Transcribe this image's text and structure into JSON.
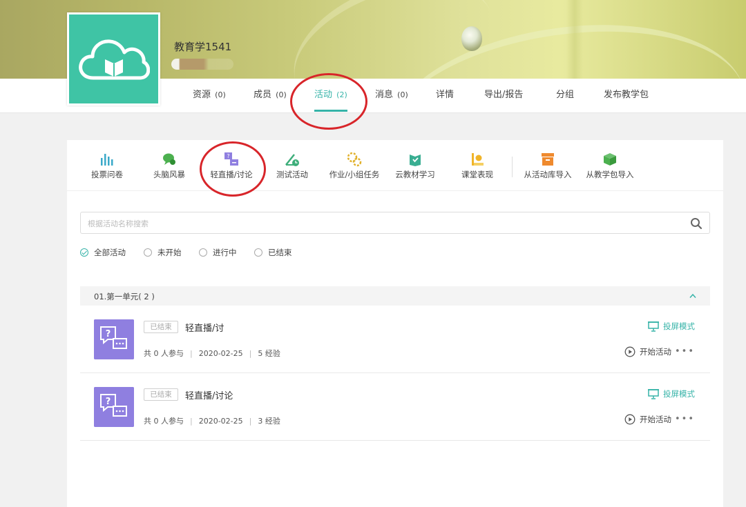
{
  "course": {
    "title": "教育学1541"
  },
  "nav_tabs": [
    {
      "label": "资源",
      "count": "(0)"
    },
    {
      "label": "成员",
      "count": "(0)"
    },
    {
      "label": "活动",
      "count": "(2)"
    },
    {
      "label": "消息",
      "count": "(0)"
    },
    {
      "label": "详情",
      "count": ""
    },
    {
      "label": "导出/报告",
      "count": ""
    },
    {
      "label": "分组",
      "count": ""
    },
    {
      "label": "发布教学包",
      "count": ""
    }
  ],
  "tools": [
    {
      "label": "投票问卷",
      "icon": "bar-chart-icon",
      "color": "#3aa9c9"
    },
    {
      "label": "头脑风暴",
      "icon": "brainstorm-icon",
      "color": "#4cb04f"
    },
    {
      "label": "轻直播/讨论",
      "icon": "live-discussion-icon",
      "color": "#8f7fe0"
    },
    {
      "label": "测试活动",
      "icon": "test-icon",
      "color": "#3dae7a"
    },
    {
      "label": "作业/小组任务",
      "icon": "task-icon",
      "color": "#e1b12c"
    },
    {
      "label": "云教材学习",
      "icon": "cloud-textbook-icon",
      "color": "#3aae92"
    },
    {
      "label": "课堂表现",
      "icon": "performance-icon",
      "color": "#f0b429"
    },
    {
      "label": "从活动库导入",
      "icon": "activity-library-icon",
      "color": "#ef8a2e"
    },
    {
      "label": "从教学包导入",
      "icon": "teaching-package-icon",
      "color": "#4cb04f"
    }
  ],
  "search": {
    "placeholder": "根据活动名称搜索"
  },
  "filters": [
    "全部活动",
    "未开始",
    "进行中",
    "已结束"
  ],
  "unit": {
    "title": "01.第一单元( 2 )"
  },
  "activities": [
    {
      "status": "已结束",
      "title": "轻直播/讨",
      "participants": "共 0 人参与",
      "date": "2020-02-25",
      "exp": "5 经验",
      "screen_mode": "投屏模式",
      "start": "开始活动",
      "more": "•••"
    },
    {
      "status": "已结束",
      "title": "轻直播/讨论",
      "participants": "共 0 人参与",
      "date": "2020-02-25",
      "exp": "3 经验",
      "screen_mode": "投屏模式",
      "start": "开始活动",
      "more": "•••"
    }
  ],
  "colors": {
    "accent": "#36b3a8",
    "logo_bg": "#3fc4a5",
    "activity_icon": "#8f7fe0",
    "annotation": "#d8252a"
  }
}
